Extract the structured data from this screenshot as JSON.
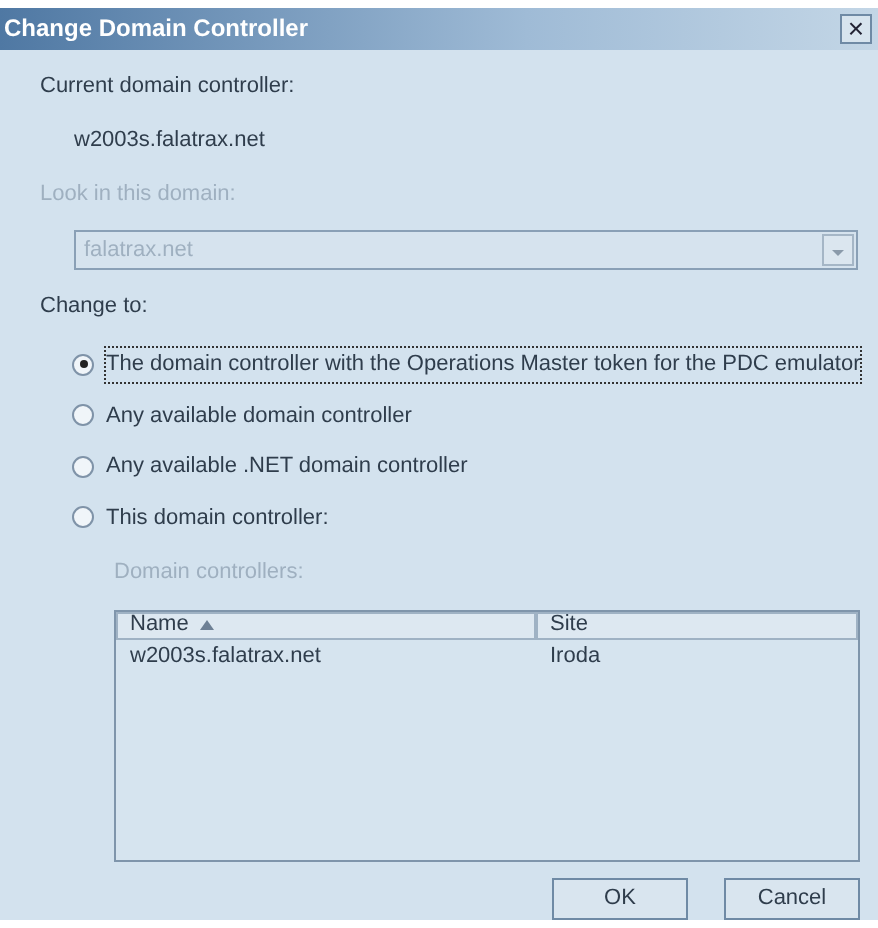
{
  "window": {
    "title": "Change Domain Controller",
    "close": "×"
  },
  "current": {
    "label": "Current domain controller:",
    "value": "w2003s.falatrax.net"
  },
  "look_in": {
    "label": "Look in this domain:",
    "value": "falatrax.net",
    "disabled": true
  },
  "change_to": {
    "label": "Change to:",
    "options": [
      {
        "label": "The domain controller with the Operations Master token for the PDC emulator",
        "selected": true
      },
      {
        "label": "Any available domain controller",
        "selected": false
      },
      {
        "label": "Any available .NET domain controller",
        "selected": false
      },
      {
        "label": "This domain controller:",
        "selected": false
      }
    ]
  },
  "domain_controllers": {
    "label": "Domain controllers:",
    "disabled": true,
    "columns": [
      {
        "label": "Name",
        "sorted": true
      },
      {
        "label": "Site",
        "sorted": false
      }
    ],
    "rows": [
      {
        "cells": [
          "w2003s.falatrax.net",
          "Iroda"
        ]
      }
    ]
  },
  "buttons": [
    "OK",
    "Cancel"
  ]
}
